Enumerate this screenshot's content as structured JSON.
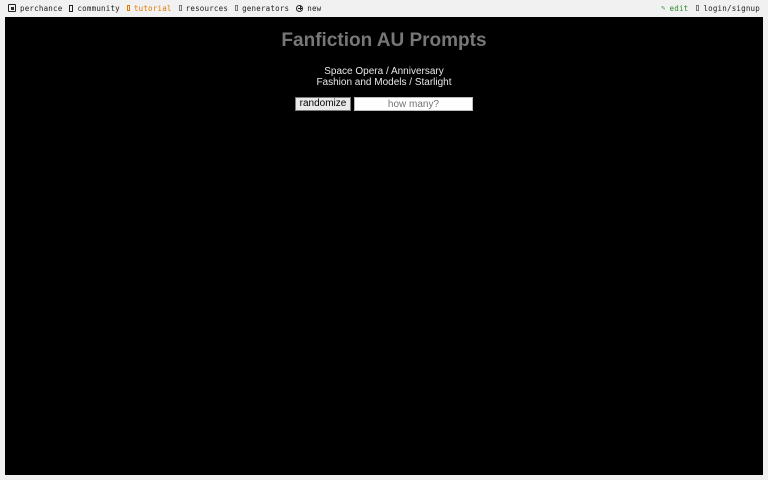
{
  "nav": {
    "left": [
      {
        "label": "perchance",
        "icon": "dice-icon"
      },
      {
        "label": "community",
        "icon": "chat-icon"
      },
      {
        "label": "tutorial",
        "icon": "book-icon"
      },
      {
        "label": "resources",
        "icon": "book-icon"
      },
      {
        "label": "generators",
        "icon": "book-icon"
      },
      {
        "label": "new",
        "icon": "plus-circle-icon"
      }
    ],
    "right": [
      {
        "label": "edit",
        "icon": "pencil-icon"
      },
      {
        "label": "login/signup",
        "icon": "user-icon"
      }
    ]
  },
  "colors": {
    "tutorial": "#e07a00",
    "edit": "#2a8a2a",
    "stage_bg": "#000000",
    "title": "#777777"
  },
  "main": {
    "title": "Fanfiction AU Prompts",
    "result_line1": "Space Opera / Anniversary",
    "result_line2": "Fashion and Models / Starlight",
    "randomize_label": "randomize",
    "count_placeholder": "how many?"
  }
}
